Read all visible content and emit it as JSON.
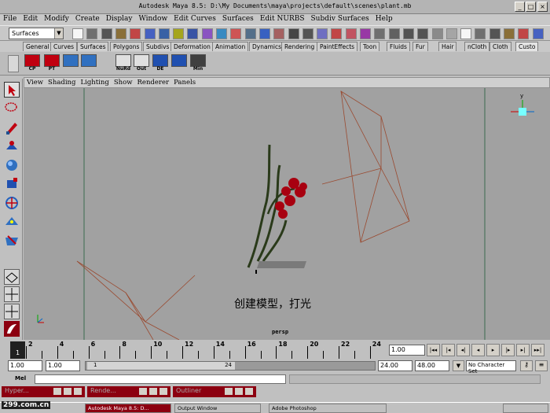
{
  "window": {
    "title": "Autodesk Maya 8.5: D:\\My Documents\\maya\\projects\\default\\scenes\\plant.mb"
  },
  "menu": [
    "File",
    "Edit",
    "Modify",
    "Create",
    "Display",
    "Window",
    "Edit Curves",
    "Surfaces",
    "Edit NURBS",
    "Subdiv Surfaces",
    "Help"
  ],
  "status": {
    "menu_set": "Surfaces"
  },
  "shelf_tabs": [
    "General",
    "Curves",
    "Surfaces",
    "Polygons",
    "Subdivs",
    "Deformation",
    "Animation",
    "Dynamics",
    "Rendering",
    "PaintEffects",
    "Toon",
    "Fluids",
    "Fur",
    "Hair",
    "nCloth",
    "Cloth",
    "Custo"
  ],
  "shelf_labels": [
    "CP",
    "PT",
    "",
    "",
    "NuRd",
    "Out",
    "DE",
    "",
    "Min"
  ],
  "panel_menu": [
    "View",
    "Shading",
    "Lighting",
    "Show",
    "Renderer",
    "Panels"
  ],
  "viewport": {
    "caption": "创建模型，打光",
    "camera": "persp"
  },
  "timeline": {
    "ticks": [
      "2",
      "4",
      "6",
      "8",
      "10",
      "12",
      "14",
      "16",
      "18",
      "20",
      "22",
      "24"
    ],
    "current": "1",
    "current_frame": "1.00"
  },
  "range": {
    "start": "1.00",
    "playback_start": "1.00",
    "slider_start": "1",
    "slider_end": "24",
    "playback_end": "24.00",
    "end": "48.00",
    "character_set": "No Character Set"
  },
  "cmdline": {
    "label": "Mel"
  },
  "minimized": [
    "Hyper...",
    "Rende...",
    "Outliner"
  ],
  "taskbar": [
    "Autodesk Maya 8.5: D...",
    "Output Window",
    "Adobe Photoshop"
  ],
  "watermark": "299.com.cn",
  "colors": {
    "viewport": "#a1a1a1",
    "accent_red": "#8c0010",
    "plant_red": "#a80010",
    "leaf": "#2a3a1a"
  }
}
